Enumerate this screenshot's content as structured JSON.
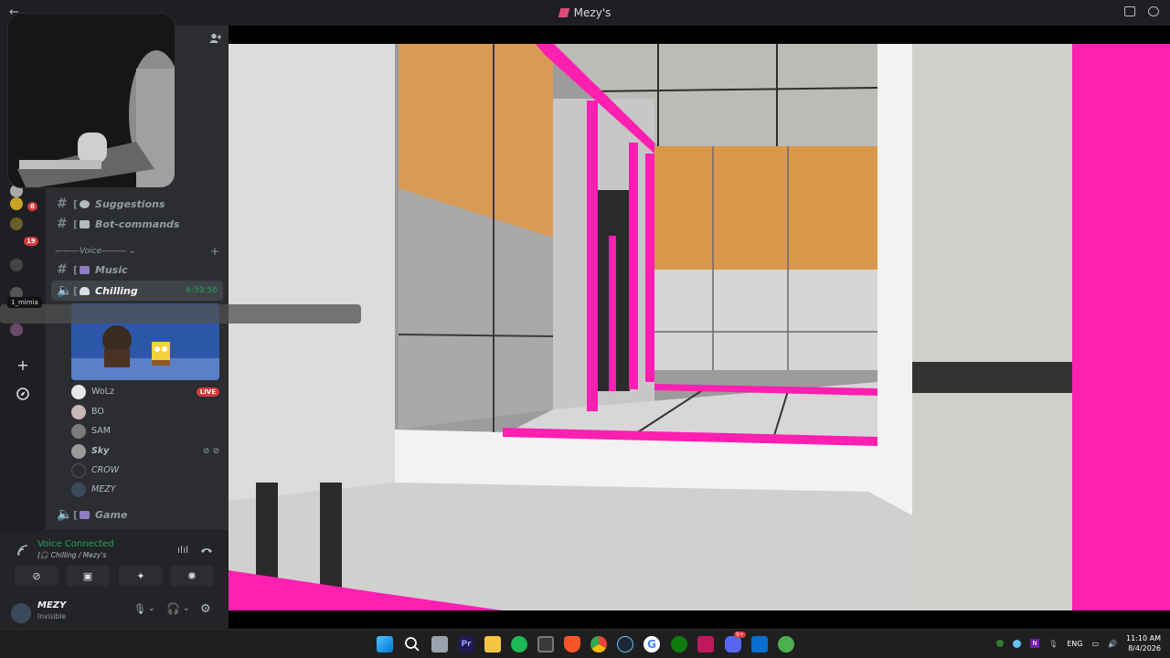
{
  "window": {
    "title": "Mezy's"
  },
  "channels": [
    {
      "name": "Suggestions"
    },
    {
      "name": "Bot-commands"
    }
  ],
  "voice_category": "Voice",
  "voice_channels": {
    "music": "Music",
    "chilling": "Chilling",
    "chilling_timer": "6:59:56",
    "game": "Game"
  },
  "members": [
    {
      "name": "WoLz",
      "live": "LIVE"
    },
    {
      "name": "BO"
    },
    {
      "name": "SAM"
    },
    {
      "name": "Sky"
    },
    {
      "name": "CROW"
    },
    {
      "name": "MEZY"
    }
  ],
  "server_badges": [
    "6",
    "19"
  ],
  "tooltip": "1_mimia",
  "voice_panel": {
    "status": "Voice Connected",
    "location": "Chilling / Mezy's"
  },
  "user": {
    "name": "MEZY",
    "status": "Invisible"
  },
  "taskbar": {
    "lang": "ENG",
    "time": "11:10 AM",
    "date": "8/4/2026",
    "discord_badge": "9+"
  },
  "colors": {
    "online_green": "#23a55a",
    "live_red": "#da373c",
    "magenta_accent": "#ff1fb0"
  }
}
